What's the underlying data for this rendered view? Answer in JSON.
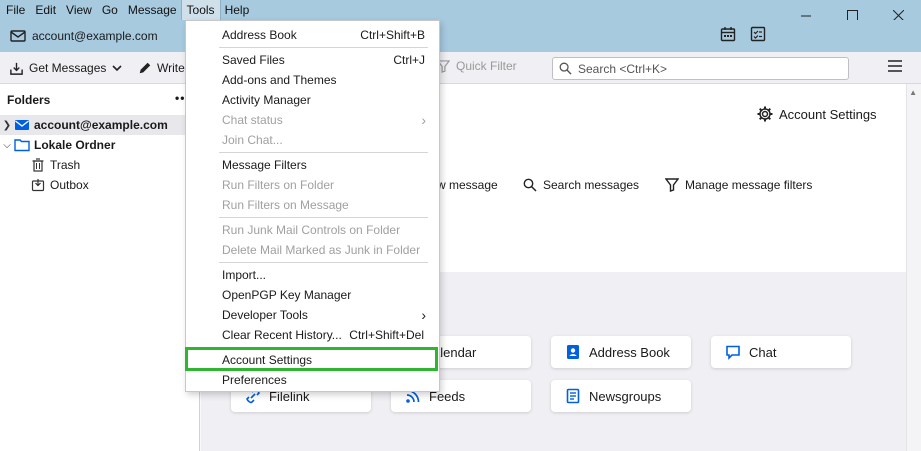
{
  "menubar": {
    "items": [
      "File",
      "Edit",
      "View",
      "Go",
      "Message",
      "Tools",
      "Help"
    ],
    "active": "Tools"
  },
  "account": {
    "email": "account@example.com"
  },
  "toolbar": {
    "get_messages": "Get Messages",
    "write": "Write",
    "quick_filter": "Quick Filter",
    "search_placeholder": "Search <Ctrl+K>"
  },
  "folders": {
    "header": "Folders",
    "more": "••",
    "items": [
      {
        "label": "account@example.com",
        "icon": "mail-account-icon"
      },
      {
        "label": "Lokale Ordner",
        "icon": "folder-icon"
      },
      {
        "label": "Trash",
        "icon": "trash-icon"
      },
      {
        "label": "Outbox",
        "icon": "outbox-icon"
      }
    ]
  },
  "main": {
    "account_settings": "Account Settings",
    "actions": {
      "new_message_partial": "w message",
      "search_messages": "Search messages",
      "manage_filters": "Manage message filters"
    },
    "cards": {
      "calendar_partial": "alendar",
      "address_book": "Address Book",
      "chat": "Chat",
      "filelink": "Filelink",
      "feeds": "Feeds",
      "newsgroups": "Newsgroups"
    }
  },
  "tools_menu": {
    "address_book": {
      "label": "Address Book",
      "shortcut": "Ctrl+Shift+B"
    },
    "saved_files": {
      "label": "Saved Files",
      "shortcut": "Ctrl+J"
    },
    "addons": {
      "label": "Add-ons and Themes"
    },
    "activity": {
      "label": "Activity Manager"
    },
    "chat_status": {
      "label": "Chat status"
    },
    "join_chat": {
      "label": "Join Chat..."
    },
    "message_filters": {
      "label": "Message Filters"
    },
    "run_filters_folder": {
      "label": "Run Filters on Folder"
    },
    "run_filters_message": {
      "label": "Run Filters on Message"
    },
    "run_junk": {
      "label": "Run Junk Mail Controls on Folder"
    },
    "delete_junk": {
      "label": "Delete Mail Marked as Junk in Folder"
    },
    "import": {
      "label": "Import..."
    },
    "openpgp": {
      "label": "OpenPGP Key Manager"
    },
    "developer_tools": {
      "label": "Developer Tools"
    },
    "clear_history": {
      "label": "Clear Recent History...",
      "shortcut": "Ctrl+Shift+Del"
    },
    "account_settings": {
      "label": "Account Settings"
    },
    "preferences": {
      "label": "Preferences"
    }
  },
  "colors": {
    "highlight": "#2fb52f",
    "accent": "#0060df",
    "titlebar": "#a7cadf"
  }
}
